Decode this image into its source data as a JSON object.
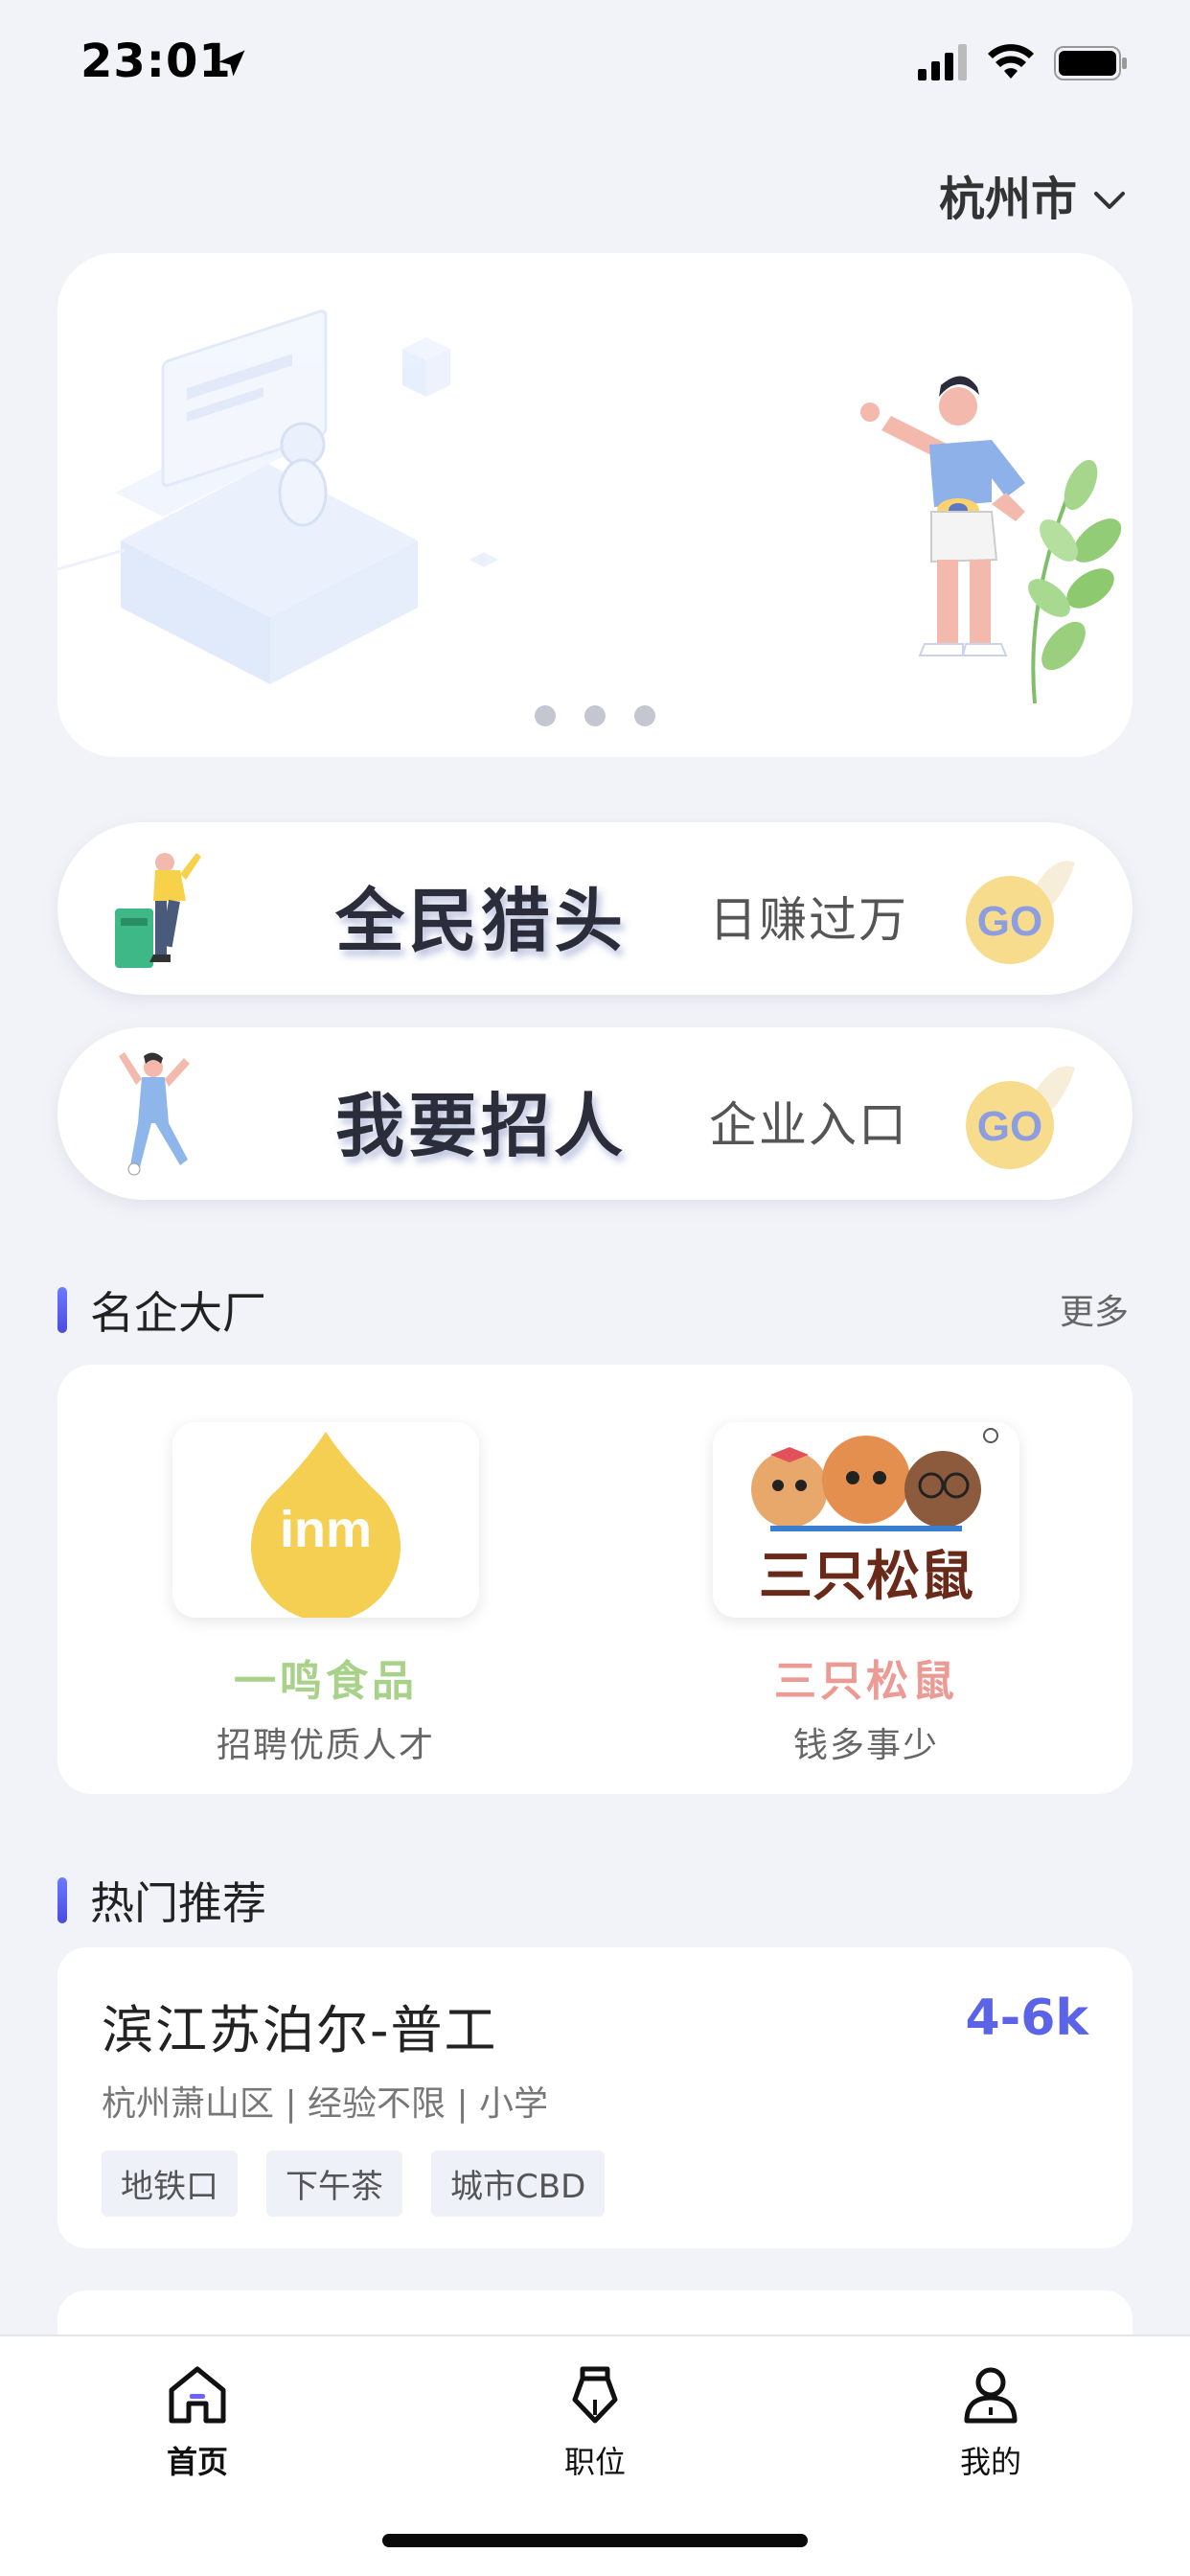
{
  "status_bar": {
    "time": "23:01",
    "icons": [
      "location-arrow-icon",
      "signal-icon",
      "wifi-icon",
      "battery-icon"
    ]
  },
  "city_selector": {
    "city": "杭州市",
    "icon": "chevron-down-icon"
  },
  "banner": {
    "slide_count": 3
  },
  "promos": [
    {
      "title": "全民猎头",
      "subtitle": "日赚过万",
      "button": "GO"
    },
    {
      "title": "我要招人",
      "subtitle": "企业入口",
      "button": "GO"
    }
  ],
  "famous_companies": {
    "title": "名企大厂",
    "more": "更多",
    "items": [
      {
        "logo_text": "inm",
        "name": "一鸣食品",
        "slogan": "招聘优质人才",
        "name_color": "#a8d18a"
      },
      {
        "logo_text": "三只松鼠",
        "name": "三只松鼠",
        "slogan": "钱多事少",
        "name_color": "#ec9a94"
      }
    ]
  },
  "hot_recommend": {
    "title": "热门推荐",
    "jobs": [
      {
        "title": "滨江苏泊尔-普工",
        "salary": "4-6k",
        "meta": "杭州萧山区 | 经验不限 | 小学",
        "tags": [
          "地铁口",
          "下午茶",
          "城市CBD"
        ]
      }
    ]
  },
  "tabbar": {
    "items": [
      {
        "label": "首页",
        "icon": "home-icon",
        "active": true
      },
      {
        "label": "职位",
        "icon": "briefcase-icon",
        "active": false
      },
      {
        "label": "我的",
        "icon": "user-icon",
        "active": false
      }
    ]
  },
  "colors": {
    "accent": "#5b63e6",
    "background": "#f1f3f8"
  }
}
